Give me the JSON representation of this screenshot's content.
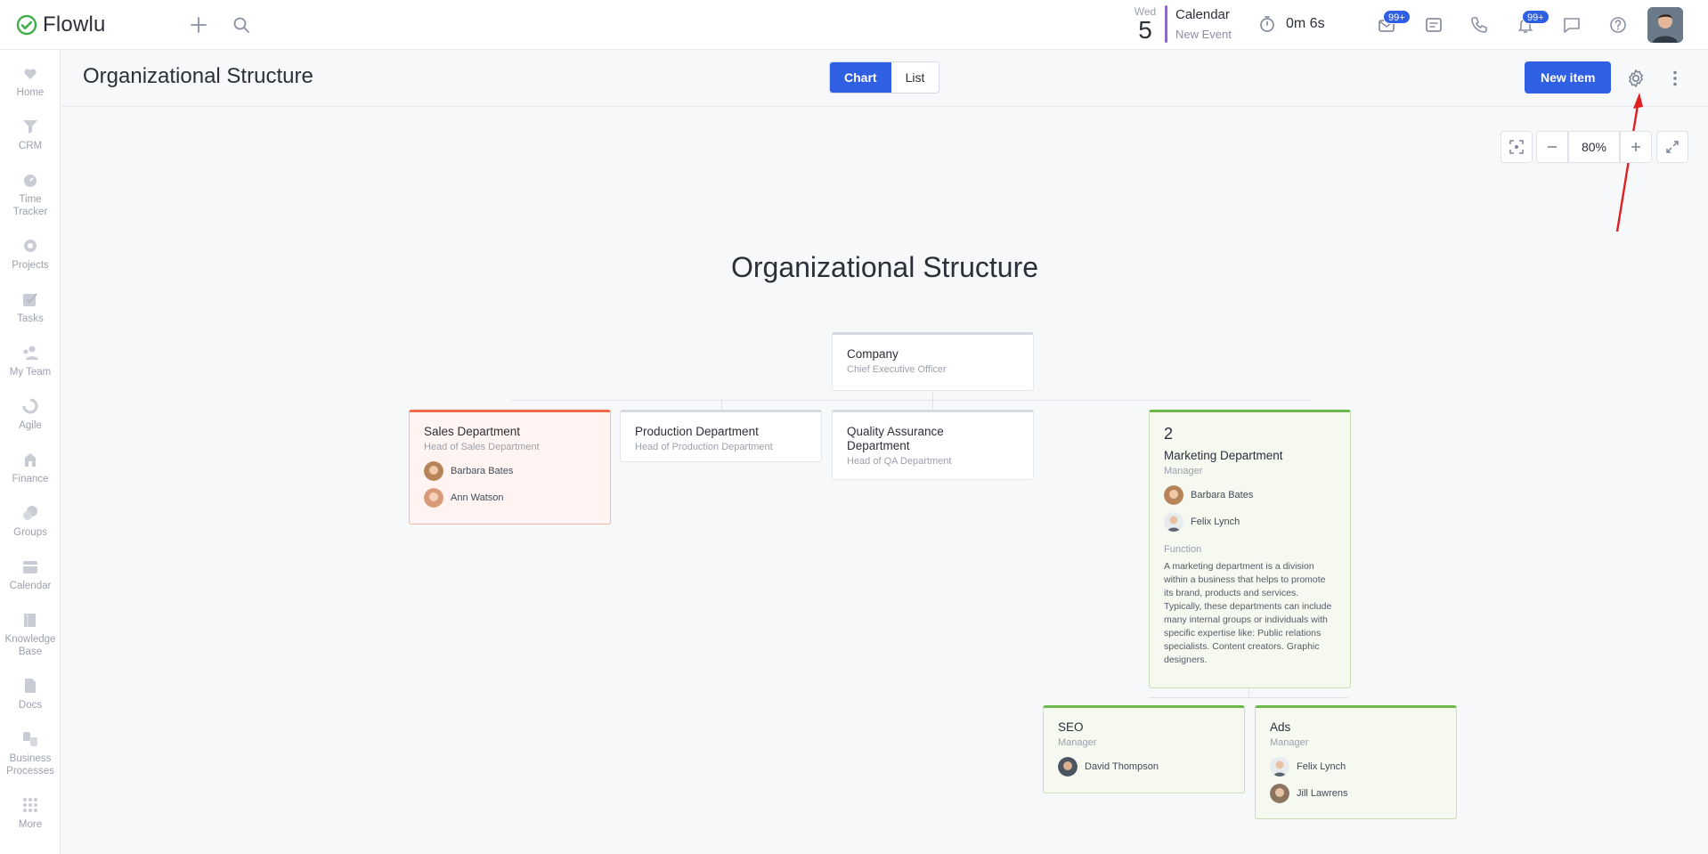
{
  "app": {
    "name": "Flowlu"
  },
  "topbar": {
    "date_dow": "Wed",
    "date_day": "5",
    "calendar_title": "Calendar",
    "calendar_sub": "New Event",
    "timer": "0m 6s",
    "mail_badge": "99+",
    "notif_badge": "99+"
  },
  "sidebar": {
    "items": [
      {
        "label": "Home",
        "icon": "home-icon"
      },
      {
        "label": "CRM",
        "icon": "crm-icon"
      },
      {
        "label": "Time Tracker",
        "icon": "time-tracker-icon"
      },
      {
        "label": "Projects",
        "icon": "projects-icon"
      },
      {
        "label": "Tasks",
        "icon": "tasks-icon"
      },
      {
        "label": "My Team",
        "icon": "team-icon"
      },
      {
        "label": "Agile",
        "icon": "agile-icon"
      },
      {
        "label": "Finance",
        "icon": "finance-icon"
      },
      {
        "label": "Groups",
        "icon": "groups-icon"
      },
      {
        "label": "Calendar",
        "icon": "calendar-icon"
      },
      {
        "label": "Knowledge Base",
        "icon": "knowledge-base-icon"
      },
      {
        "label": "Docs",
        "icon": "docs-icon"
      },
      {
        "label": "Business Processes",
        "icon": "business-processes-icon"
      },
      {
        "label": "More",
        "icon": "more-grid-icon"
      }
    ]
  },
  "header": {
    "title": "Organizational Structure",
    "view_chart": "Chart",
    "view_list": "List",
    "new_item": "New item"
  },
  "zoom": {
    "value": "80%"
  },
  "chart": {
    "title": "Organizational Structure",
    "company": {
      "title": "Company",
      "role": "Chief Executive Officer"
    },
    "sales": {
      "title": "Sales Department",
      "role": "Head of Sales Department",
      "people": [
        "Barbara Bates",
        "Ann Watson"
      ]
    },
    "production": {
      "title": "Production Department",
      "role": "Head of Production Department"
    },
    "qa": {
      "title": "Quality Assurance Department",
      "role": "Head of QA Department"
    },
    "marketing": {
      "number": "2",
      "title": "Marketing Department",
      "role": "Manager",
      "people": [
        "Barbara Bates",
        "Felix Lynch"
      ],
      "function_label": "Function",
      "function_text": "A marketing department is a division within a business that helps to promote its brand, products and services. Typically, these departments can include many internal groups or individuals with specific expertise like: Public relations specialists. Content creators. Graphic designers."
    },
    "seo": {
      "title": "SEO",
      "role": "Manager",
      "people": [
        "David Thompson"
      ]
    },
    "ads": {
      "title": "Ads",
      "role": "Manager",
      "people": [
        "Felix Lynch",
        "Jill Lawrens"
      ]
    }
  },
  "colors": {
    "accent": "#2f5fe3",
    "sales_border": "#f06b48",
    "marketing_border": "#6cb94a"
  }
}
